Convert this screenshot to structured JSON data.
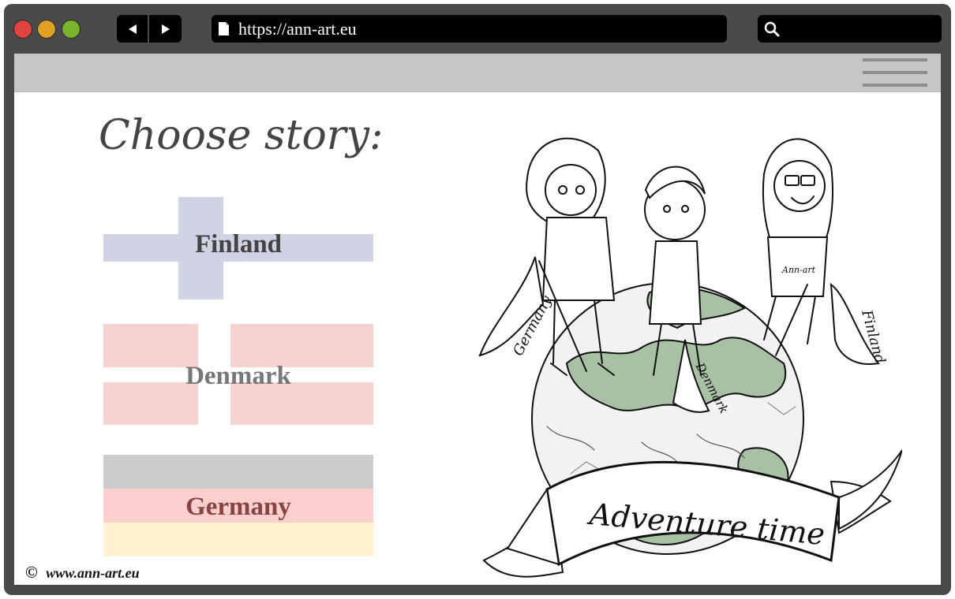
{
  "browser": {
    "url": "https://ann-art.eu",
    "controls": {
      "close_color": "#e0443e",
      "minimize_color": "#dea123",
      "zoom_color": "#7ab32c"
    },
    "back_icon": "triangle-left-icon",
    "forward_icon": "triangle-right-icon",
    "page_icon": "document-icon",
    "search_icon": "magnifier-icon"
  },
  "page": {
    "title": "Choose story:",
    "menu_icon": "hamburger-menu-icon",
    "stories": [
      {
        "label": "Finland",
        "colors": [
          "#cfd3e3",
          "#ffffff"
        ],
        "label_color": "#444444"
      },
      {
        "label": "Denmark",
        "colors": [
          "#f5d3cf",
          "#ffffff"
        ],
        "label_color": "#777777"
      },
      {
        "label": "Germany",
        "colors": [
          "#cccccc",
          "#fccfcf",
          "#fff0cf"
        ],
        "label_color": "#884444"
      }
    ],
    "illustration": {
      "banner_text": "Adventure time",
      "flags": [
        "Germany",
        "Denmark",
        "Finland"
      ],
      "shirt_text": "Ann-art"
    },
    "footer": {
      "copyright": "©",
      "site": "www.ann-art.eu"
    }
  }
}
